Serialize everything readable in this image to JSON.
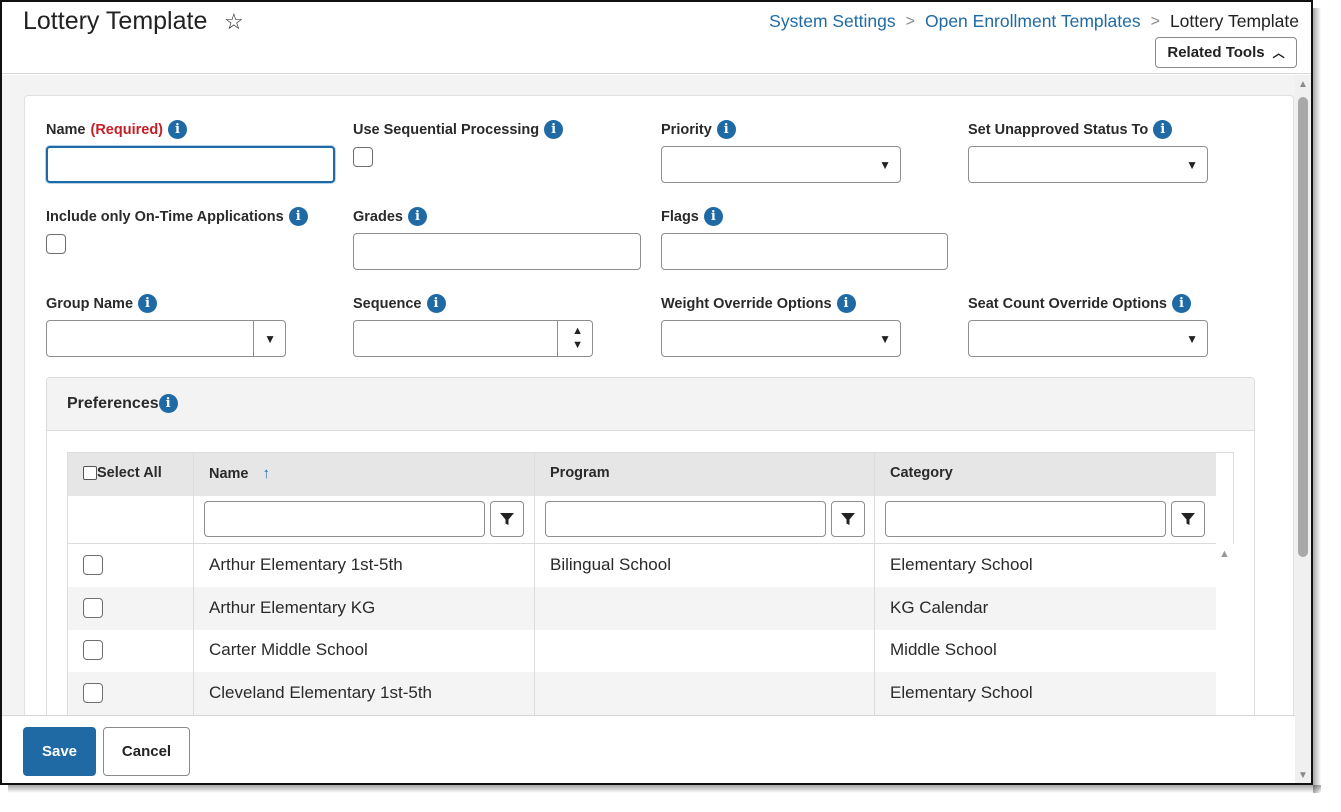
{
  "header": {
    "title": "Lottery Template",
    "favorite_icon": "star-icon",
    "breadcrumb": [
      "System Settings",
      "Open Enrollment Templates",
      "Lottery Template"
    ],
    "related_tools_label": "Related Tools"
  },
  "form": {
    "name_label": "Name",
    "required_label": "(Required)",
    "name_value": "",
    "sequential_label": "Use Sequential Processing",
    "sequential_checked": false,
    "priority_label": "Priority",
    "priority_value": "",
    "unapproved_label": "Set Unapproved Status To",
    "unapproved_value": "",
    "ontime_label": "Include only On-Time Applications",
    "ontime_checked": false,
    "grades_label": "Grades",
    "grades_value": "",
    "flags_label": "Flags",
    "flags_value": "",
    "group_label": "Group Name",
    "group_value": "",
    "sequence_label": "Sequence",
    "sequence_value": "",
    "weight_label": "Weight Override Options",
    "weight_value": "",
    "seat_label": "Seat Count Override Options",
    "seat_value": ""
  },
  "preferences": {
    "title": "Preferences",
    "columns": {
      "select_all": "Select All",
      "name": "Name",
      "program": "Program",
      "category": "Category"
    },
    "sort": "name-ascending",
    "rows": [
      {
        "name": "Arthur Elementary 1st-5th",
        "program": "Bilingual School",
        "category": "Elementary School"
      },
      {
        "name": "Arthur Elementary KG",
        "program": "",
        "category": "KG Calendar"
      },
      {
        "name": "Carter Middle School",
        "program": "",
        "category": "Middle School"
      },
      {
        "name": "Cleveland Elementary 1st-5th",
        "program": "",
        "category": "Elementary School"
      }
    ]
  },
  "footer": {
    "save_label": "Save",
    "cancel_label": "Cancel"
  },
  "colors": {
    "accent": "#1f6aa5",
    "required": "#c42027"
  }
}
